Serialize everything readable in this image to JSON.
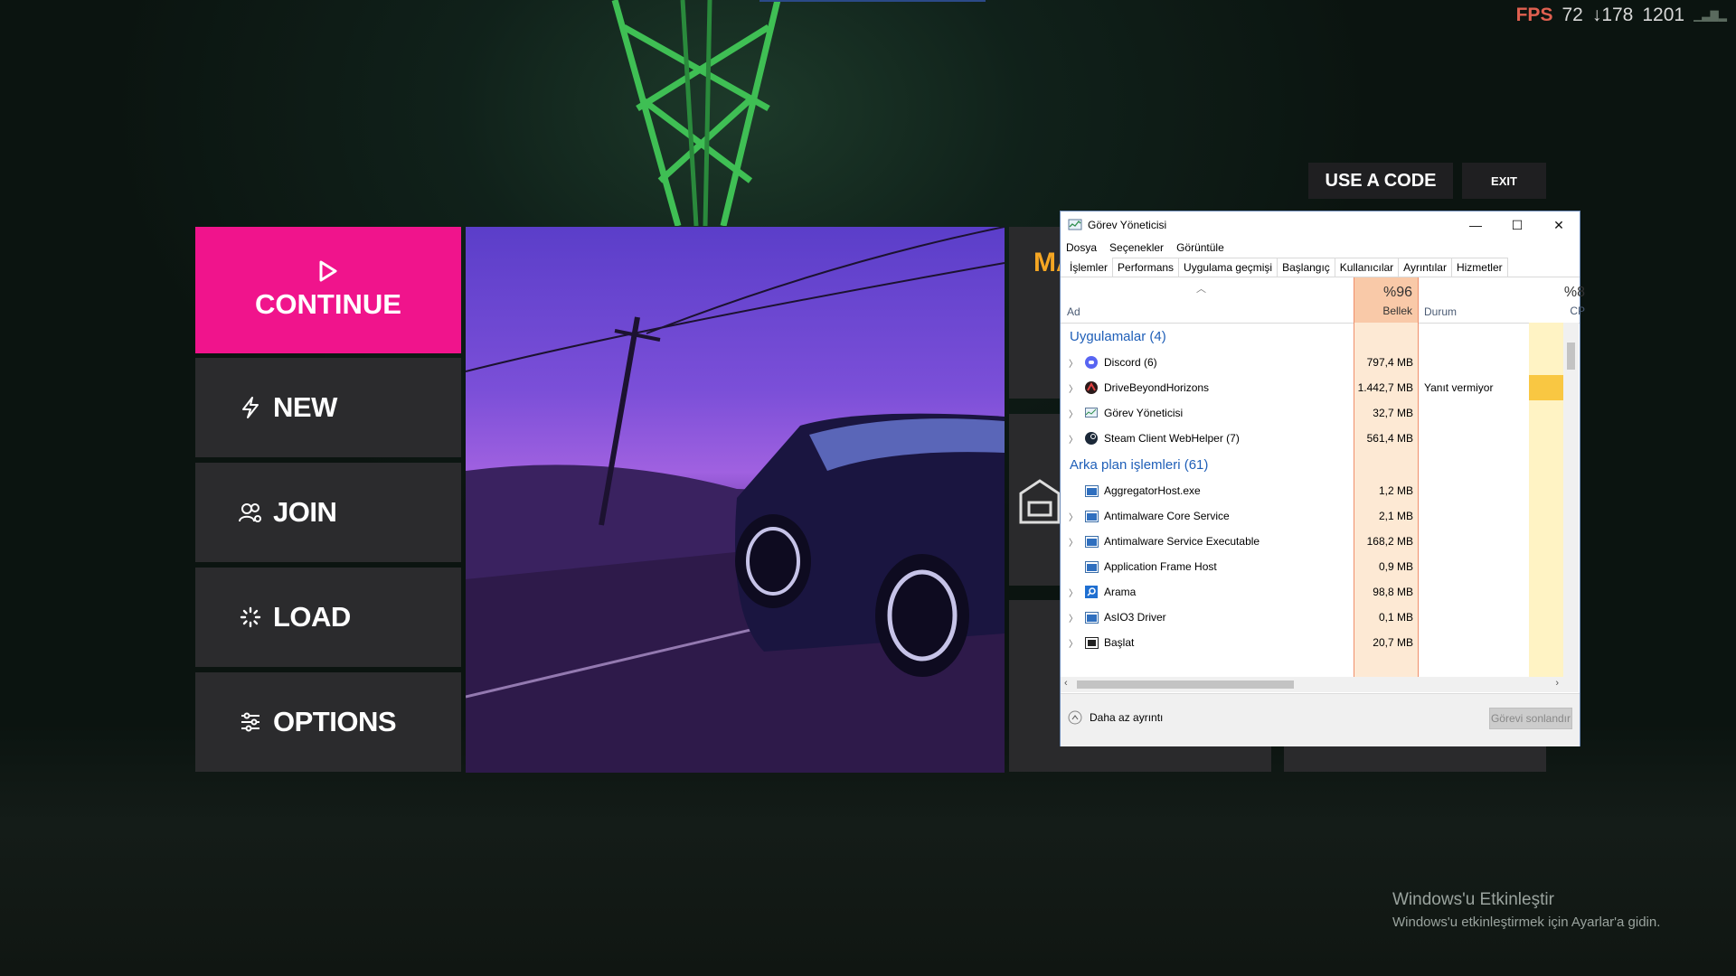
{
  "hud": {
    "fps_label": "FPS",
    "fps_value": "72",
    "extra_a": "178",
    "extra_b": "1201"
  },
  "game_menu": {
    "continue_label": "CONTINUE",
    "new_label": "NEW",
    "join_label": "JOIN",
    "load_label": "LOAD",
    "options_label": "OPTIONS",
    "right_card_text": "MA"
  },
  "top_buttons": {
    "use_code": "USE A CODE",
    "exit": "EXIT"
  },
  "task_manager": {
    "title": "Görev Yöneticisi",
    "menu": [
      "Dosya",
      "Seçenekler",
      "Görüntüle"
    ],
    "tabs": [
      "İşlemler",
      "Performans",
      "Uygulama geçmişi",
      "Başlangıç",
      "Kullanıcılar",
      "Ayrıntılar",
      "Hizmetler"
    ],
    "columns": {
      "name": "Ad",
      "memory_pct": "%96",
      "memory": "Bellek",
      "status": "Durum",
      "cpu_pct": "%8",
      "cpu": "CP"
    },
    "apps_group": "Uygulamalar (4)",
    "apps": [
      {
        "name": "Discord (6)",
        "memory": "797,4 MB",
        "status": "",
        "icon": "discord-icon"
      },
      {
        "name": "DriveBeyondHorizons",
        "memory": "1.442,7 MB",
        "status": "Yanıt vermiyor",
        "icon": "game-icon"
      },
      {
        "name": "Görev Yöneticisi",
        "memory": "32,7 MB",
        "status": "",
        "icon": "task-manager-icon"
      },
      {
        "name": "Steam Client WebHelper (7)",
        "memory": "561,4 MB",
        "status": "",
        "icon": "steam-icon"
      }
    ],
    "bg_group": "Arka plan işlemleri (61)",
    "background": [
      {
        "name": "AggregatorHost.exe",
        "memory": "1,2 MB",
        "expand": false
      },
      {
        "name": "Antimalware Core Service",
        "memory": "2,1 MB",
        "expand": true
      },
      {
        "name": "Antimalware Service Executable",
        "memory": "168,2 MB",
        "expand": true
      },
      {
        "name": "Application Frame Host",
        "memory": "0,9 MB",
        "expand": false
      },
      {
        "name": "Arama",
        "memory": "98,8 MB",
        "expand": true
      },
      {
        "name": "AsIO3 Driver",
        "memory": "0,1 MB",
        "expand": true
      },
      {
        "name": "Başlat",
        "memory": "20,7 MB",
        "expand": true
      }
    ],
    "fewer_details": "Daha az ayrıntı",
    "end_task": "Görevi sonlandır"
  },
  "watermark": {
    "line1": "Windows'u Etkinleştir",
    "line2": "Windows'u etkinleştirmek için Ayarlar'a gidin."
  }
}
